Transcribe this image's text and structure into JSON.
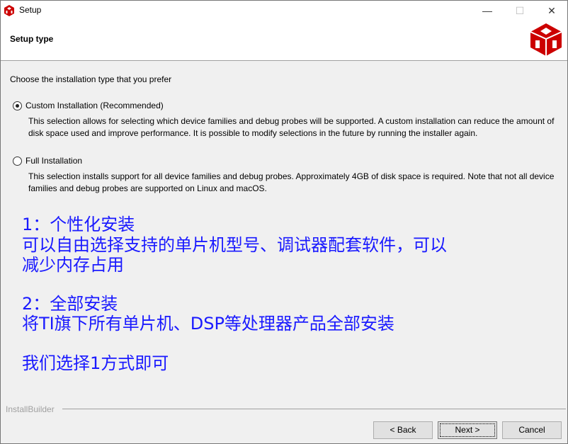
{
  "window": {
    "title": "Setup",
    "minimize_icon": "minimize-icon",
    "maximize_icon": "maximize-icon",
    "close_icon": "close-icon",
    "brand_color": "#cc0000"
  },
  "header": {
    "title": "Setup type"
  },
  "main": {
    "prompt": "Choose the installation type that you prefer",
    "options": [
      {
        "label": "Custom Installation (Recommended)",
        "selected": true,
        "description": "This selection allows for selecting which device families and debug probes will be supported.  A custom installation can reduce the amount of disk space used and improve performance.  It is possible to modify selections in the future by running the installer again."
      },
      {
        "label": "Full Installation",
        "selected": false,
        "description": "This selection installs support for all device families and debug probes.  Approximately 4GB of disk space is required.  Note that not all device families and debug probes are supported on Linux and macOS."
      }
    ]
  },
  "annotation": {
    "color": "#1a1aff",
    "lines": [
      "1：个性化安装",
      "可以自由选择支持的单片机型号、调试器配套软件，可以",
      "减少内存占用",
      "2：全部安装",
      "将TI旗下所有单片机、DSP等处理器产品全部安装",
      "我们选择1方式即可"
    ]
  },
  "footer": {
    "brand": "InstallBuilder",
    "back": "< Back",
    "next": "Next >",
    "cancel": "Cancel"
  }
}
